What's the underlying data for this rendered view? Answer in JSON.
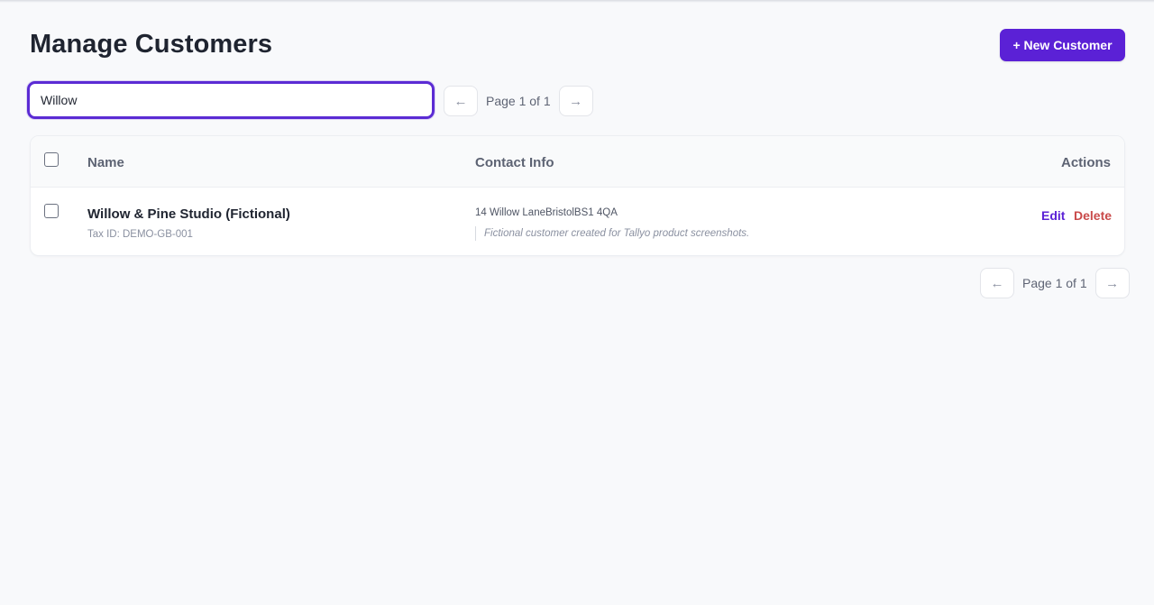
{
  "header": {
    "title": "Manage Customers",
    "new_button_label": "+ New Customer"
  },
  "search": {
    "value": "Willow"
  },
  "pagination": {
    "prev_arrow": "←",
    "next_arrow": "→",
    "label": "Page 1 of 1"
  },
  "table": {
    "columns": {
      "name": "Name",
      "contact": "Contact Info",
      "actions": "Actions"
    },
    "rows": [
      {
        "name": "Willow & Pine Studio (Fictional)",
        "tax_id": "Tax ID: DEMO-GB-001",
        "address": "14 Willow LaneBristolBS1 4QA",
        "note": "Fictional customer created for Tallyo product screenshots.",
        "edit_label": "Edit",
        "delete_label": "Delete"
      }
    ]
  },
  "colors": {
    "accent": "#5b21d6",
    "danger": "#c94a4a"
  }
}
